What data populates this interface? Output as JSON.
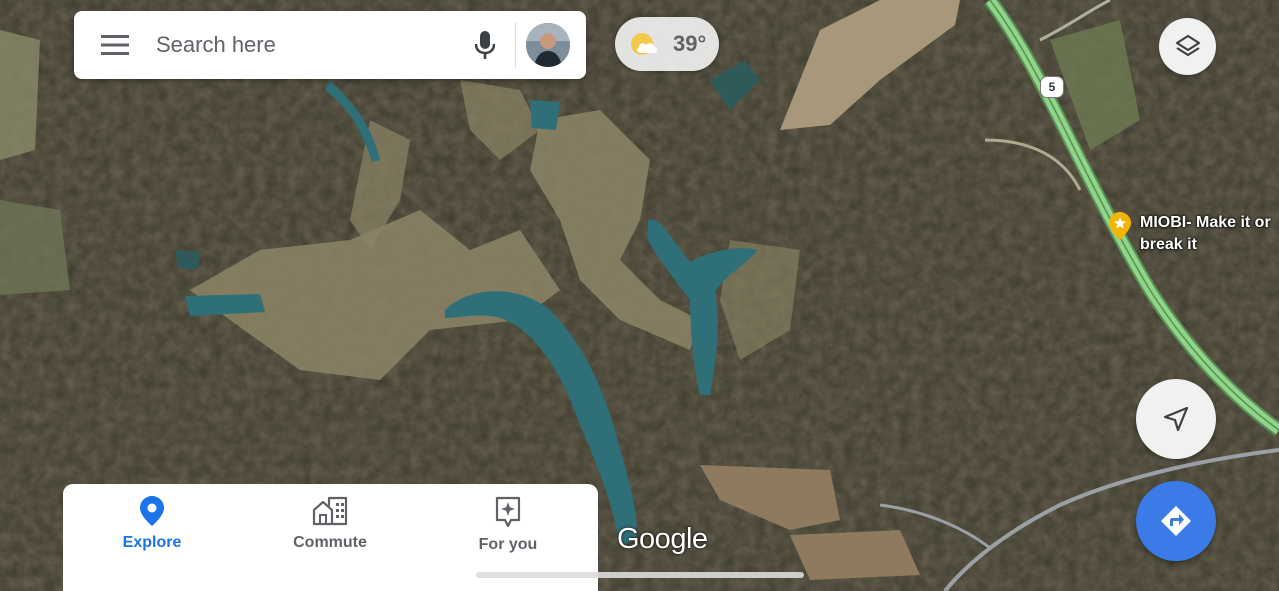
{
  "search": {
    "placeholder": "Search here",
    "menu_icon": "hamburger-menu-icon",
    "mic_icon": "microphone-icon"
  },
  "weather": {
    "temperature": "39°",
    "icon": "partly-cloudy-moon-icon"
  },
  "map": {
    "route_number": "5",
    "poi_label": "MIOBI- Make it or break it",
    "attribution": "Google"
  },
  "controls": {
    "layers_icon": "layers-icon",
    "location_icon": "navigation-arrow-icon",
    "directions_icon": "directions-icon"
  },
  "tabs": [
    {
      "label": "Explore",
      "icon": "location-pin-icon",
      "active": true
    },
    {
      "label": "Commute",
      "icon": "commute-buildings-icon",
      "active": false
    },
    {
      "label": "For you",
      "icon": "sparkle-bookmark-icon",
      "active": false
    }
  ],
  "colors": {
    "accent": "#1a73e8",
    "directions_button": "#3b7be8",
    "road": "#8fd68a",
    "water": "#2e6f78"
  }
}
